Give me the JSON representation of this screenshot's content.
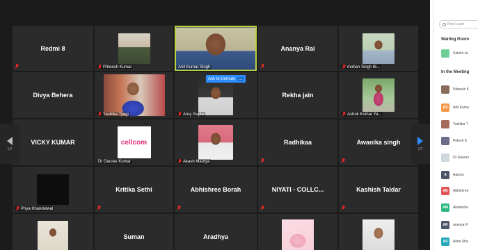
{
  "gallery": {
    "pager_prev_page": "1/2",
    "pager_next_page": "1/2",
    "unmute_tip": "Ask to Unmute",
    "unmute_more": "...",
    "tiles": [
      {
        "name": "Redmi 8",
        "label": ""
      },
      {
        "name": "",
        "label": "Priteesh Kumar"
      },
      {
        "name": "",
        "label": "Anil Kumar Singh"
      },
      {
        "name": "Ananya Rai",
        "label": ""
      },
      {
        "name": "",
        "label": "mohan Singh Bi..."
      },
      {
        "name": "Divya Behera",
        "label": ""
      },
      {
        "name": "",
        "label": "Yashika Tyagi"
      },
      {
        "name": "",
        "label": "Anuj Gupta"
      },
      {
        "name": "Rekha jain",
        "label": ""
      },
      {
        "name": "",
        "label": "Ashok Kumar Ya..."
      },
      {
        "name": "VICKY KUMAR",
        "label": ""
      },
      {
        "name": "",
        "label": "Dr Gaurav Kumar",
        "logo": "cellcom"
      },
      {
        "name": "",
        "label": "Akash Maurya"
      },
      {
        "name": "Radhikaa",
        "label": ""
      },
      {
        "name": "Awanika singh",
        "label": ""
      },
      {
        "name": "",
        "label": "Priya Khandelwal"
      },
      {
        "name": "Kritika Sethi",
        "label": ""
      },
      {
        "name": "Abhishree Borah",
        "label": ""
      },
      {
        "name": "NIYATI - COLLC...",
        "label": ""
      },
      {
        "name": "Kashish Taldar",
        "label": ""
      },
      {
        "name": "",
        "label": ""
      },
      {
        "name": "Suman",
        "label": ""
      },
      {
        "name": "Aradhya",
        "label": ""
      },
      {
        "name": "",
        "label": ""
      },
      {
        "name": "",
        "label": ""
      }
    ]
  },
  "participants_panel": {
    "search_placeholder": "Find a part",
    "waiting_room_title": "Waiting Room",
    "waiting": [
      {
        "name": "Sakshi Ja",
        "initials": "",
        "color": "#6fcf97"
      }
    ],
    "in_meeting_title": "In the Meeting",
    "in_meeting": [
      {
        "name": "Priteesh K",
        "initials": "",
        "color": "#8a6d5a"
      },
      {
        "name": "Anil Kuma",
        "initials": "AS",
        "color": "#f2994a"
      },
      {
        "name": "Yashika T",
        "initials": "",
        "color": "#a66a5a"
      },
      {
        "name": "Pritesh K",
        "initials": "",
        "color": "#6b6b8a"
      },
      {
        "name": "Dr Gaurav",
        "initials": "",
        "color": "#cfd8dc"
      },
      {
        "name": "Aarzoo",
        "initials": "A",
        "color": "#4a5568"
      },
      {
        "name": "Abhishree",
        "initials": "AB",
        "color": "#e05555"
      },
      {
        "name": "Akanksha",
        "initials": "AM",
        "color": "#2db87d"
      },
      {
        "name": "ananya R",
        "initials": "AR",
        "color": "#4a5568"
      },
      {
        "name": "Anita Sha",
        "initials": "AS",
        "color": "#27a9b8"
      }
    ]
  },
  "colors": {
    "active_speaker": "#b9d443",
    "mic_muted": "#e02828",
    "next_arrow": "#2d8cff",
    "prev_arrow": "#bcbcbc"
  }
}
